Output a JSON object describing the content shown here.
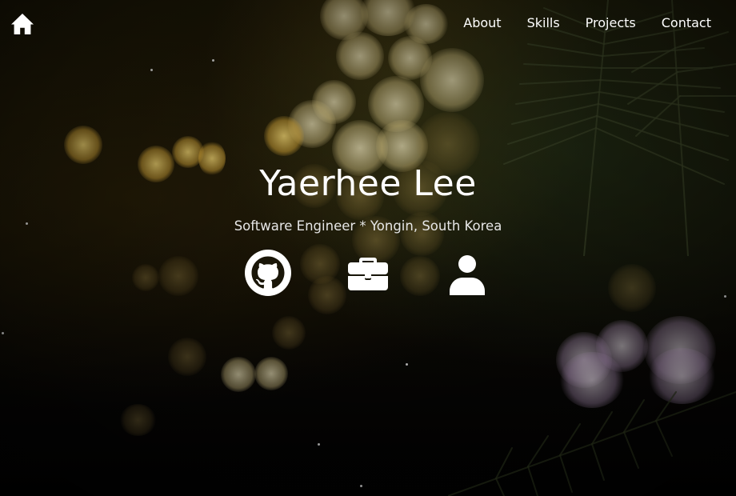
{
  "nav": {
    "home_icon": "home-icon",
    "items": [
      {
        "label": "About"
      },
      {
        "label": "Skills"
      },
      {
        "label": "Projects"
      },
      {
        "label": "Contact"
      }
    ]
  },
  "hero": {
    "name": "Yaerhee Lee",
    "subtitle": "Software Engineer * Yongin, South Korea"
  },
  "social_links": [
    {
      "icon": "github-icon"
    },
    {
      "icon": "briefcase-icon"
    },
    {
      "icon": "user-icon"
    }
  ],
  "colors": {
    "text": "#ffffff",
    "subtitle": "#e6e6e6",
    "bokeh_gold": "#f2cf6e",
    "background": "#0c0a04"
  }
}
